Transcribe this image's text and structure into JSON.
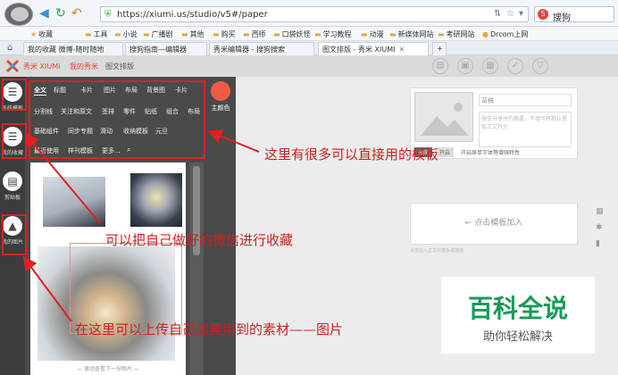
{
  "browser": {
    "url": "https://xiumi.us/studio/v5#/paper",
    "search_text": "搜狗",
    "bookmarks": [
      {
        "label": "收藏"
      },
      {
        "label": "工具"
      },
      {
        "label": "小说"
      },
      {
        "label": "广播剧"
      },
      {
        "label": "其他"
      },
      {
        "label": "购买"
      },
      {
        "label": "西师"
      },
      {
        "label": "口袋妖怪"
      },
      {
        "label": "学习教程"
      },
      {
        "label": "动漫"
      },
      {
        "label": "新媒体网站"
      },
      {
        "label": "考研网站"
      },
      {
        "label": "Drcom上网"
      }
    ],
    "tabs": [
      {
        "label": "我的收藏 微博-随时随地"
      },
      {
        "label": "搜狗指南—编辑器"
      },
      {
        "label": "秀米编辑器 - 搜狗搜索"
      },
      {
        "label": "图文排版 - 秀米 XIUMI"
      }
    ]
  },
  "app": {
    "header": {
      "logo_name": "秀米 XIUMI",
      "nav": [
        "我的秀米",
        "图文排版"
      ]
    },
    "sidebar": [
      {
        "label": "系统模板",
        "icon": "list-icon"
      },
      {
        "label": "我的收藏",
        "icon": "favorites-icon"
      },
      {
        "label": "剪贴板",
        "icon": "clipboard-icon"
      },
      {
        "label": "我的图片",
        "icon": "image-icon"
      }
    ],
    "categories": {
      "row1": [
        "全文",
        "标题",
        "卡片",
        "图片",
        "布局",
        "背景图",
        "卡片"
      ],
      "row2": [
        "分割线",
        "关注和原文",
        "签排",
        "零件",
        "贴纸",
        "组合",
        "布局"
      ],
      "row3": [
        "基础组件",
        "同步专题",
        "滑动",
        "收纳模板",
        "元旦"
      ],
      "row4": [
        "最近使用",
        "样刊模板",
        "更多..."
      ]
    },
    "main_color_label": "主颜色",
    "gallery_footer": "— 滚动查看下一份图片 —",
    "editor": {
      "title_placeholder": "草稿",
      "summary_placeholder": "微信分享时的摘要，不填写将默认提取正文开头",
      "btn_close": "关闭",
      "btn_open": "开启",
      "share_label": "开启原单字体等增强特性"
    },
    "placeholder_text": "← 点击模板加入",
    "placeholder_hint": "点击插入正文的模板或拖拽"
  },
  "annotations": {
    "a1": "这里有很多可以直接用的模板",
    "a2": "可以把自己做好的微信进行收藏",
    "a3": "在这里可以上传自己需要用到的素材——图片"
  },
  "watermark": {
    "title": "百科全说",
    "subtitle": "助你轻松解决"
  }
}
